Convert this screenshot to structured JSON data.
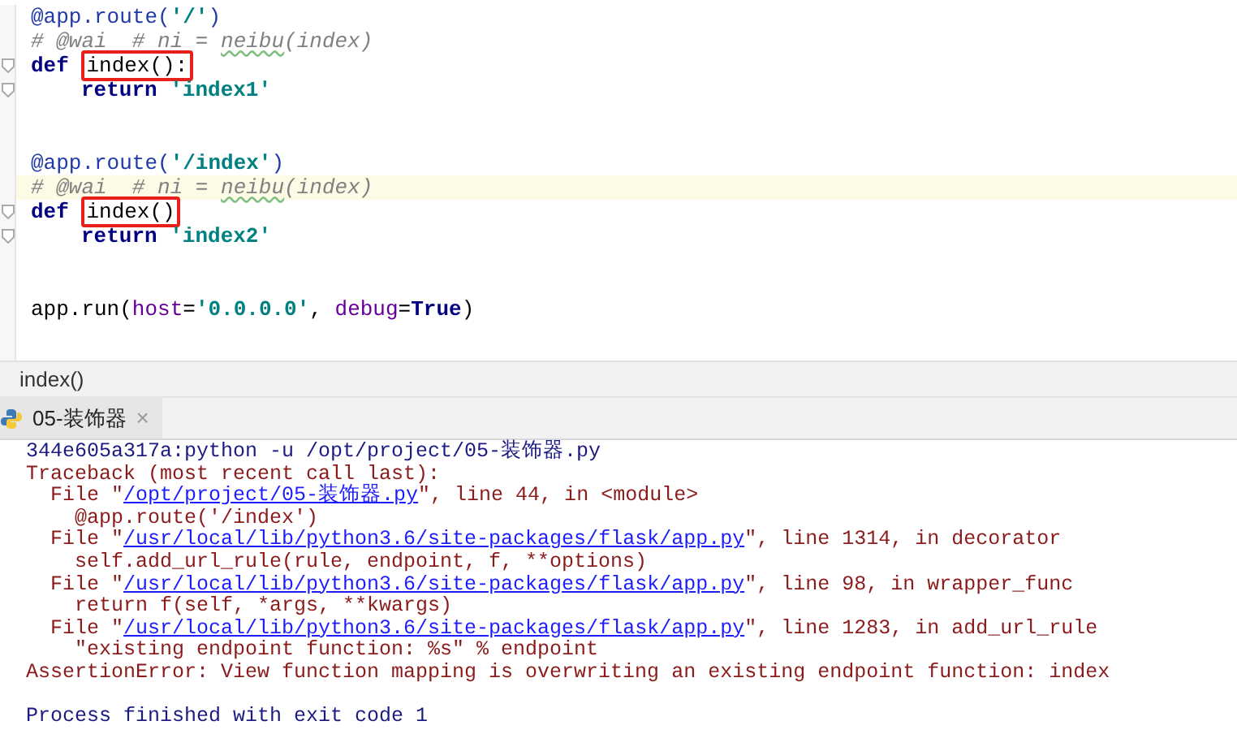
{
  "editor": {
    "lines": [
      {
        "kind": "code",
        "fold": false,
        "current": false,
        "segments": [
          {
            "kind": "decorator",
            "text": "@app.route("
          },
          {
            "kind": "string",
            "text": "'/'"
          },
          {
            "kind": "decorator",
            "text": ")"
          }
        ]
      },
      {
        "kind": "code",
        "fold": false,
        "current": false,
        "segments": [
          {
            "kind": "comment",
            "text": "# @wai  # ni = "
          },
          {
            "kind": "typo",
            "text": "neibu"
          },
          {
            "kind": "comment",
            "text": "(index)"
          }
        ]
      },
      {
        "kind": "code",
        "fold": true,
        "current": false,
        "segments": [
          {
            "kind": "keyword",
            "text": "def "
          },
          {
            "kind": "plain",
            "text": "index():",
            "boxed": true
          }
        ]
      },
      {
        "kind": "body",
        "fold": true,
        "current": false,
        "segments": [
          {
            "kind": "keyword",
            "text": "return "
          },
          {
            "kind": "string",
            "text": "'index1'"
          }
        ]
      },
      {
        "kind": "blank",
        "fold": false,
        "current": false
      },
      {
        "kind": "blank",
        "fold": false,
        "current": false
      },
      {
        "kind": "code",
        "fold": false,
        "current": false,
        "segments": [
          {
            "kind": "decorator",
            "text": "@app.route("
          },
          {
            "kind": "string",
            "text": "'/index'"
          },
          {
            "kind": "decorator",
            "text": ")"
          }
        ]
      },
      {
        "kind": "code",
        "fold": false,
        "current": true,
        "segments": [
          {
            "kind": "comment",
            "text": "# @wai  # ni = "
          },
          {
            "kind": "typo",
            "text": "neibu"
          },
          {
            "kind": "comment",
            "text": "(index)"
          }
        ]
      },
      {
        "kind": "code",
        "fold": true,
        "current": false,
        "segments": [
          {
            "kind": "keyword",
            "text": "def "
          },
          {
            "kind": "plain",
            "text": "index()",
            "boxed": true
          }
        ]
      },
      {
        "kind": "body",
        "fold": true,
        "current": false,
        "segments": [
          {
            "kind": "keyword",
            "text": "return "
          },
          {
            "kind": "string",
            "text": "'index2'"
          }
        ]
      },
      {
        "kind": "blank",
        "fold": false,
        "current": false
      },
      {
        "kind": "blank",
        "fold": false,
        "current": false
      },
      {
        "kind": "code",
        "fold": false,
        "current": false,
        "segments": [
          {
            "kind": "plain",
            "text": "app.run("
          },
          {
            "kind": "param",
            "text": "host"
          },
          {
            "kind": "plain",
            "text": "="
          },
          {
            "kind": "string",
            "text": "'0.0.0.0'"
          },
          {
            "kind": "plain",
            "text": ", "
          },
          {
            "kind": "param",
            "text": "debug"
          },
          {
            "kind": "plain",
            "text": "="
          },
          {
            "kind": "keyword",
            "text": "True"
          },
          {
            "kind": "plain",
            "text": ")"
          }
        ]
      }
    ]
  },
  "breadcrumb": "index()",
  "run_tabs": [
    {
      "label": "05-装饰器",
      "close": "×",
      "selected": true
    }
  ],
  "console": {
    "lines": [
      {
        "kind": "text",
        "segments": [
          {
            "kind": "info",
            "text": "344e605a317a:python -u /opt/project/05-装饰器.py"
          }
        ]
      },
      {
        "kind": "text",
        "segments": [
          {
            "kind": "error",
            "text": "Traceback (most recent call last):"
          }
        ]
      },
      {
        "kind": "text",
        "segments": [
          {
            "kind": "error",
            "text": "  File \""
          },
          {
            "kind": "link",
            "text": "/opt/project/05-装饰器.py"
          },
          {
            "kind": "error",
            "text": "\", line 44, in <module>"
          }
        ]
      },
      {
        "kind": "text",
        "segments": [
          {
            "kind": "error",
            "text": "    @app.route('/index')"
          }
        ]
      },
      {
        "kind": "text",
        "segments": [
          {
            "kind": "error",
            "text": "  File \""
          },
          {
            "kind": "link",
            "text": "/usr/local/lib/python3.6/site-packages/flask/app.py"
          },
          {
            "kind": "error",
            "text": "\", line 1314, in decorator"
          }
        ]
      },
      {
        "kind": "text",
        "segments": [
          {
            "kind": "error",
            "text": "    self.add_url_rule(rule, endpoint, f, **options)"
          }
        ]
      },
      {
        "kind": "text",
        "segments": [
          {
            "kind": "error",
            "text": "  File \""
          },
          {
            "kind": "link",
            "text": "/usr/local/lib/python3.6/site-packages/flask/app.py"
          },
          {
            "kind": "error",
            "text": "\", line 98, in wrapper_func"
          }
        ]
      },
      {
        "kind": "text",
        "segments": [
          {
            "kind": "error",
            "text": "    return f(self, *args, **kwargs)"
          }
        ]
      },
      {
        "kind": "text",
        "segments": [
          {
            "kind": "error",
            "text": "  File \""
          },
          {
            "kind": "link",
            "text": "/usr/local/lib/python3.6/site-packages/flask/app.py"
          },
          {
            "kind": "error",
            "text": "\", line 1283, in add_url_rule"
          }
        ]
      },
      {
        "kind": "text",
        "segments": [
          {
            "kind": "error",
            "text": "    \"existing endpoint function: %s\" % endpoint"
          }
        ]
      },
      {
        "kind": "text",
        "segments": [
          {
            "kind": "error",
            "text": "AssertionError: View function mapping is overwriting an existing endpoint function: index"
          }
        ]
      },
      {
        "kind": "blank"
      },
      {
        "kind": "text",
        "segments": [
          {
            "kind": "info",
            "text": "Process finished with exit code 1"
          }
        ]
      }
    ]
  }
}
